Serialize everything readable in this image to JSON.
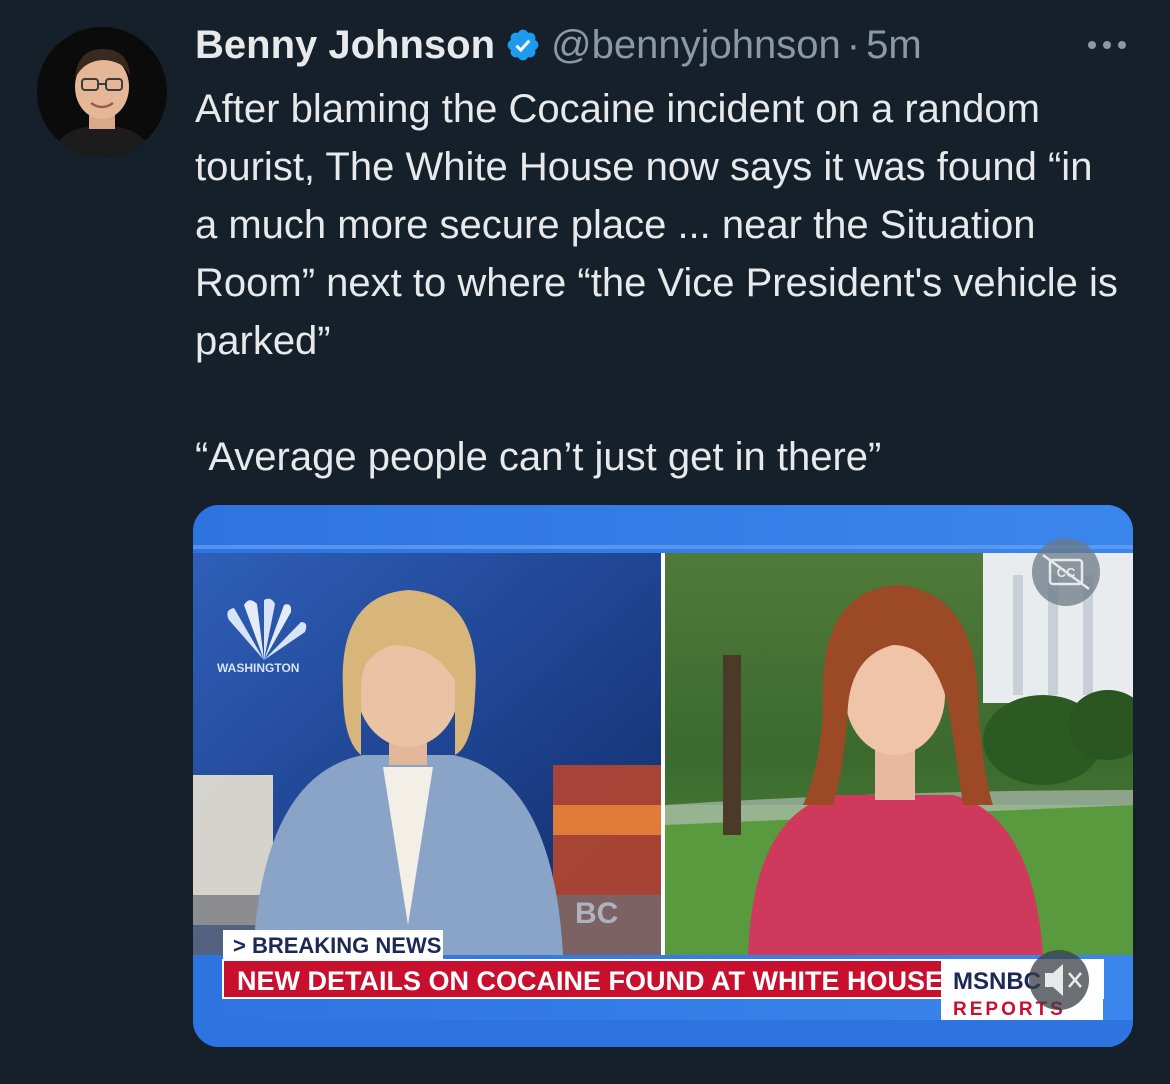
{
  "tweet": {
    "author_name": "Benny Johnson",
    "handle": "@bennyjohnson",
    "separator": "·",
    "time": "5m",
    "paragraph_1": "After blaming the Cocaine incident on a random tourist, The White House now says it was found “in a much more secure place ... near the Situation Room” next to where “the Vice President's vehicle is parked”",
    "paragraph_2": "“Average people can’t just get in there”"
  },
  "media": {
    "breaking_label": "> BREAKING NEWS",
    "headline": "NEW DETAILS ON COCAINE FOUND AT WHITE HOUSE",
    "network": "MSNBC",
    "network_sub": "REPORTS",
    "studio_logo_text": "WASHINGTON",
    "studio_wall_text": "BC",
    "caption_button": "CC"
  },
  "icons": {
    "verified": "verified-badge-icon",
    "more": "more-options-icon",
    "captions": "closed-captions-icon",
    "mute": "speaker-mute-icon"
  },
  "colors": {
    "background": "#15202b",
    "text": "#e7e9ea",
    "secondary": "#8b98a5",
    "verified": "#1d9bf0",
    "breaking_red": "#c8102e",
    "frame_blue": "#2a6fdc"
  }
}
